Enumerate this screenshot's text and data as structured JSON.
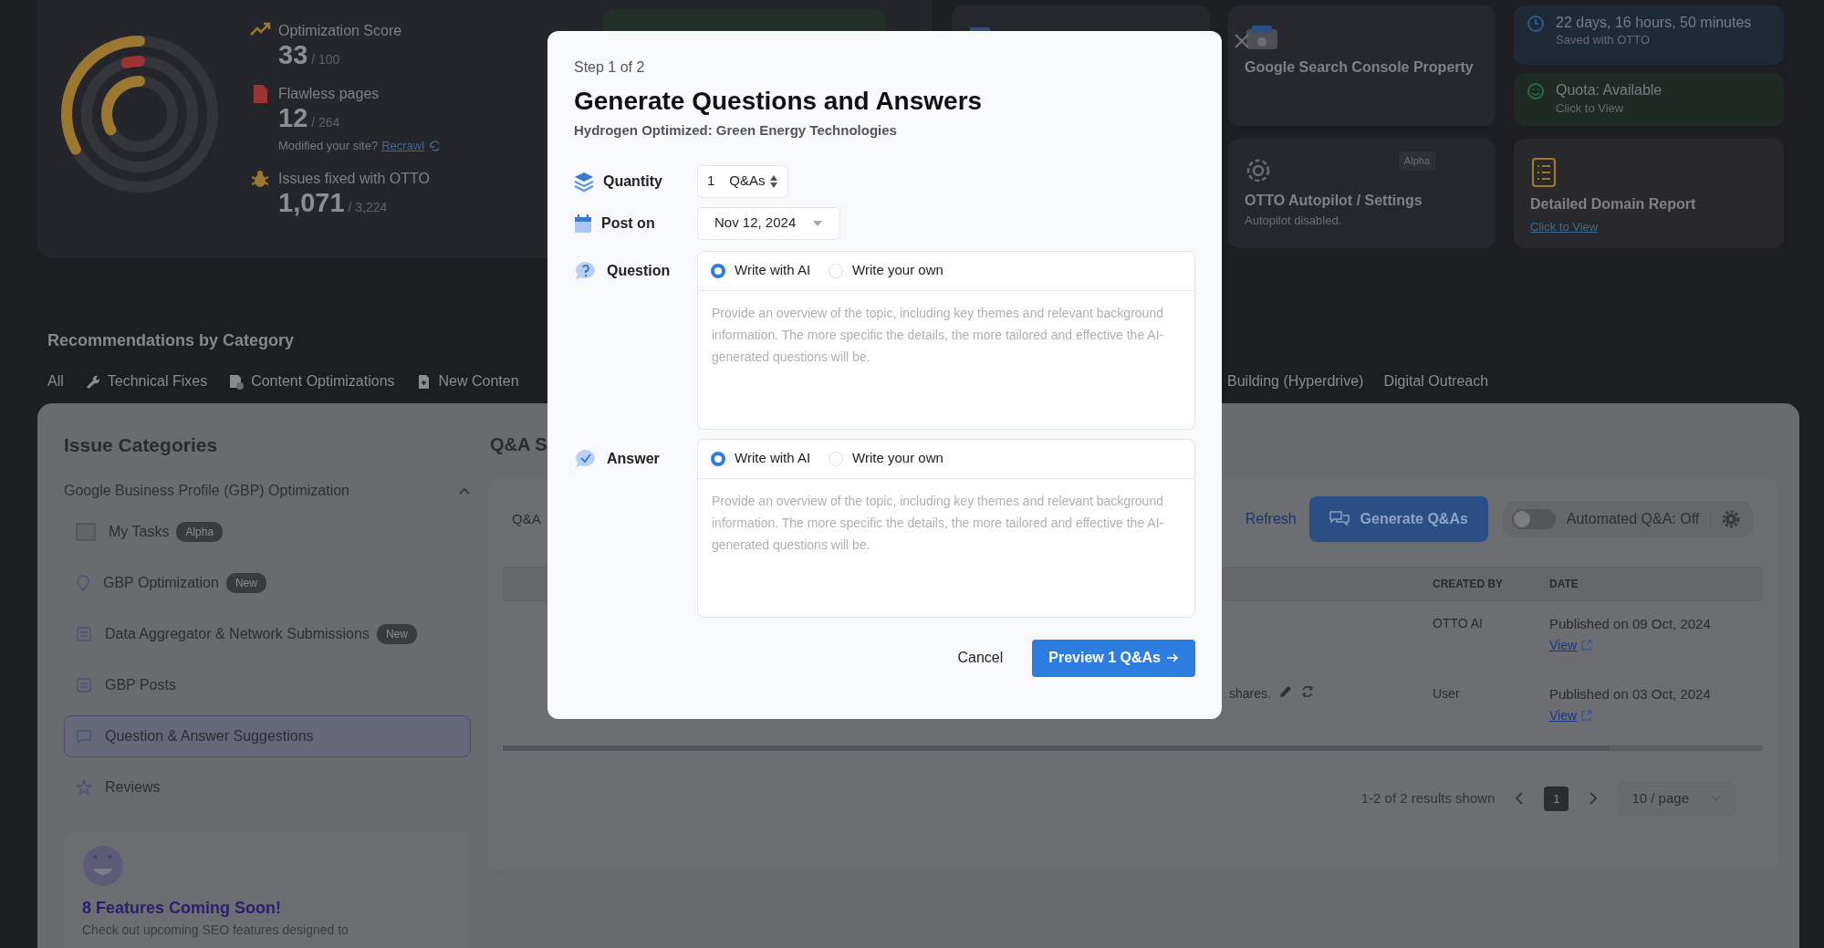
{
  "overview": {
    "metrics": [
      {
        "kind": "score",
        "label": "Optimization Score",
        "value": "33",
        "total": "/ 100"
      },
      {
        "kind": "pages",
        "label": "Flawless pages",
        "value": "12",
        "total": "/ 264",
        "note": "Modified your site?",
        "link": "Recrawl"
      },
      {
        "kind": "issues",
        "label": "Issues fixed with OTTO",
        "value": "1,071",
        "total": "/ 3,224"
      }
    ]
  },
  "cards": [
    {
      "kind": "gsc",
      "title": "Google Search Console Property"
    },
    {
      "kind": "time",
      "title": "22 days, 16 hours, 50 minutes",
      "subtitle": "Saved with OTTO"
    },
    {
      "kind": "quota",
      "title": "Quota: Available",
      "subtitle": "Click to View"
    },
    {
      "kind": "settings",
      "title": "OTTO Autopilot / Settings",
      "subtitle": "Autopilot disabled.",
      "badge": "Alpha"
    },
    {
      "kind": "report",
      "title": "Detailed Domain Report",
      "link": "Click to View"
    }
  ],
  "recommendations": {
    "title": "Recommendations by Category",
    "tabs": [
      {
        "kind": "all",
        "label": "All"
      },
      {
        "kind": "wrench",
        "label": "Technical Fixes"
      },
      {
        "kind": "doc-check",
        "label": "Content Optimizations"
      },
      {
        "kind": "doc-plus",
        "label": "New Conten"
      },
      {
        "kind": "gap"
      },
      {
        "kind": "plain",
        "label": "Building (Hyperdrive)"
      },
      {
        "kind": "plain",
        "label": "Digital Outreach"
      }
    ]
  },
  "sidebar": {
    "title": "Issue Categories",
    "group": {
      "label": "Google Business Profile (GBP) Optimization",
      "expanded": true
    },
    "items": [
      {
        "label": "My Tasks",
        "badge": "Alpha",
        "selected": false
      },
      {
        "label": "GBP Optimization",
        "badge": "New",
        "selected": false
      },
      {
        "label": "Data Aggregator & Network Submissions",
        "badge": "New",
        "selected": false
      },
      {
        "label": "GBP Posts",
        "selected": false
      },
      {
        "label": "Question & Answer Suggestions",
        "selected": true
      },
      {
        "label": "Reviews",
        "selected": false
      }
    ],
    "promo": {
      "title": "8 Features Coming Soon!",
      "text": "Check out upcoming SEO features designed to"
    }
  },
  "qa_panel": {
    "title": "Q&A S",
    "tab": "Q&A",
    "refresh": "Refresh",
    "generate": "Generate Q&As",
    "automation": {
      "label": "Automated Q&A: Off",
      "on": false
    },
    "table": {
      "columns": [
        "CREATED BY",
        "DATE"
      ],
      "rows": [
        {
          "created_by": "OTTO AI",
          "date": "Published on 09 Oct, 2024",
          "link": "View"
        },
        {
          "question": "shares.",
          "created_by": "User",
          "date": "Published on 03 Oct, 2024",
          "link": "View"
        }
      ]
    },
    "pagination": {
      "summary": "1-2 of 2 results shown",
      "pages": [
        {
          "label": "1",
          "selected": true
        }
      ],
      "per_page": "10 / page"
    }
  },
  "modal": {
    "step": "Step 1 of 2",
    "title": "Generate Questions and Answers",
    "subtitle": "Hydrogen Optimized: Green Energy Technologies",
    "quantity": {
      "label": "Quantity",
      "value": "1",
      "unit": "Q&As"
    },
    "post_on": {
      "label": "Post on",
      "value": "Nov 12, 2024"
    },
    "fields": [
      {
        "kind": "question",
        "label": "Question",
        "options": [
          {
            "label": "Write with AI",
            "selected": true
          },
          {
            "label": "Write your own",
            "selected": false
          }
        ],
        "placeholder": "Provide an overview of the topic, including key themes and relevant background information. The more specific the details, the more tailored and effective the AI-generated questions will be."
      },
      {
        "kind": "answer",
        "label": "Answer",
        "options": [
          {
            "label": "Write with AI",
            "selected": true
          },
          {
            "label": "Write your own",
            "selected": false
          }
        ],
        "placeholder": "Provide an overview of the topic, including key themes and relevant background information. The more specific the details, the more tailored and effective the AI-generated questions will be."
      }
    ],
    "cancel": "Cancel",
    "submit": "Preview 1 Q&As"
  }
}
